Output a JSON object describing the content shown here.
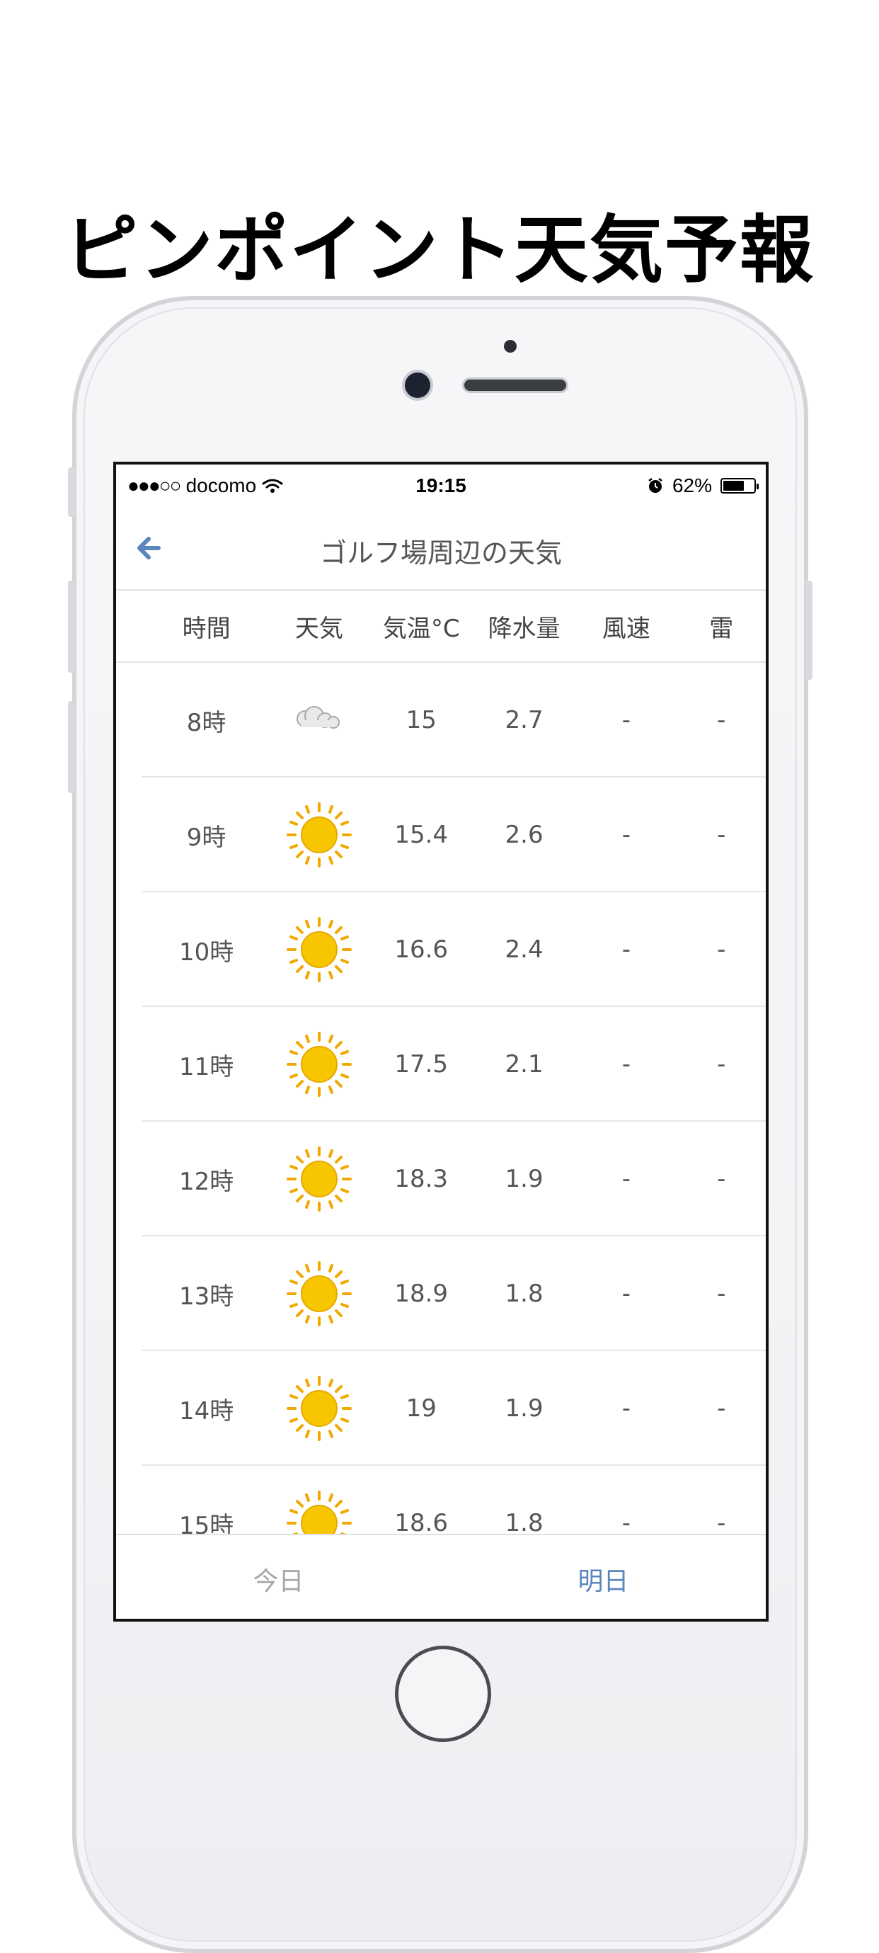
{
  "headline": "ピンポイント天気予報",
  "status_bar": {
    "carrier": "docomo",
    "signal": "●●●○○",
    "time": "19:15",
    "battery": "62%"
  },
  "nav": {
    "title": "ゴルフ場周辺の天気"
  },
  "table": {
    "headers": [
      "時間",
      "天気",
      "気温°C",
      "降水量",
      "風速",
      "雷"
    ],
    "rows": [
      {
        "hour": "8時",
        "weather": "cloudy-icon",
        "temp": "15",
        "precip": "2.7",
        "wind": "-",
        "thunder": "-"
      },
      {
        "hour": "9時",
        "weather": "sun-icon",
        "temp": "15.4",
        "precip": "2.6",
        "wind": "-",
        "thunder": "-"
      },
      {
        "hour": "10時",
        "weather": "sun-icon",
        "temp": "16.6",
        "precip": "2.4",
        "wind": "-",
        "thunder": "-"
      },
      {
        "hour": "11時",
        "weather": "sun-icon",
        "temp": "17.5",
        "precip": "2.1",
        "wind": "-",
        "thunder": "-"
      },
      {
        "hour": "12時",
        "weather": "sun-icon",
        "temp": "18.3",
        "precip": "1.9",
        "wind": "-",
        "thunder": "-"
      },
      {
        "hour": "13時",
        "weather": "sun-icon",
        "temp": "18.9",
        "precip": "1.8",
        "wind": "-",
        "thunder": "-"
      },
      {
        "hour": "14時",
        "weather": "sun-icon",
        "temp": "19",
        "precip": "1.9",
        "wind": "-",
        "thunder": "-"
      },
      {
        "hour": "15時",
        "weather": "sun-icon",
        "temp": "18.6",
        "precip": "1.8",
        "wind": "-",
        "thunder": "-"
      }
    ]
  },
  "tabs": [
    {
      "label": "今日",
      "active": false
    },
    {
      "label": "明日",
      "active": true
    }
  ],
  "colors": {
    "accent": "#5b86bd",
    "sun": "#f7c600",
    "sun_ray": "#f2a800",
    "cloud": "#c9c9c9"
  }
}
